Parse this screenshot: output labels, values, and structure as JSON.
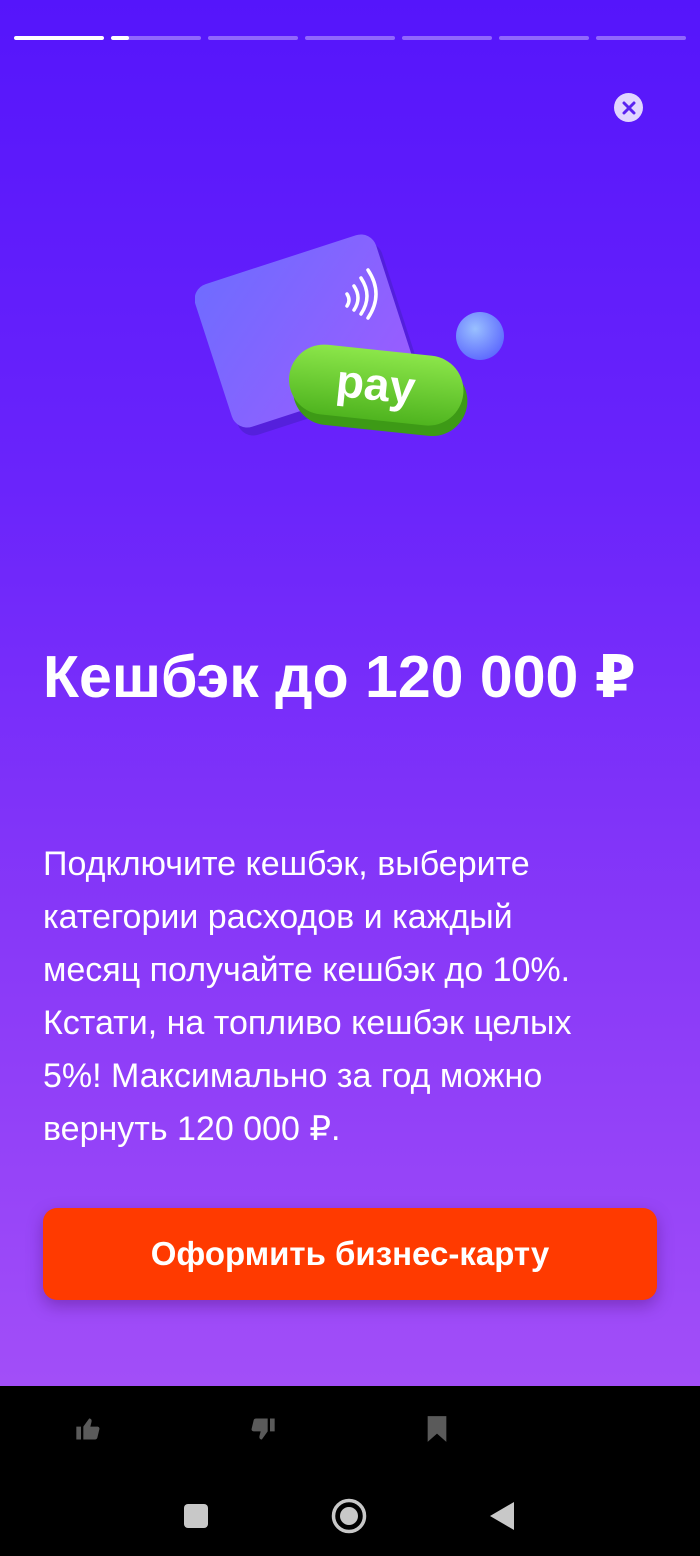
{
  "stories": {
    "count": 7,
    "progress": [
      1.0,
      0.2,
      0,
      0,
      0,
      0,
      0
    ]
  },
  "close": {
    "icon": "close-icon"
  },
  "illustration": {
    "badge_text": "pay",
    "icons": [
      "card-icon",
      "contactless-icon",
      "coin-icon"
    ]
  },
  "content": {
    "title": "Кешбэк до 120 000 ₽",
    "description": "Подключите кешбэк, выберите\nкатегории расходов и каждый\nмесяц получайте кешбэк до 10%.\nКстати, на топливо кешбэк целых\n5%! Максимально за год можно\nвернуть 120 000 ₽."
  },
  "cta": {
    "label": "Оформить бизнес-карту",
    "color": "#ff3a00"
  },
  "reactions": {
    "icons": [
      "thumbs-up-icon",
      "thumbs-down-icon",
      "bookmark-icon"
    ]
  },
  "system_nav": {
    "icons": [
      "recent-apps-icon",
      "home-icon",
      "back-icon"
    ]
  },
  "colors": {
    "gradient_top": "#5515fb",
    "gradient_bottom": "#a24ef8",
    "badge_green": "#72d635"
  }
}
